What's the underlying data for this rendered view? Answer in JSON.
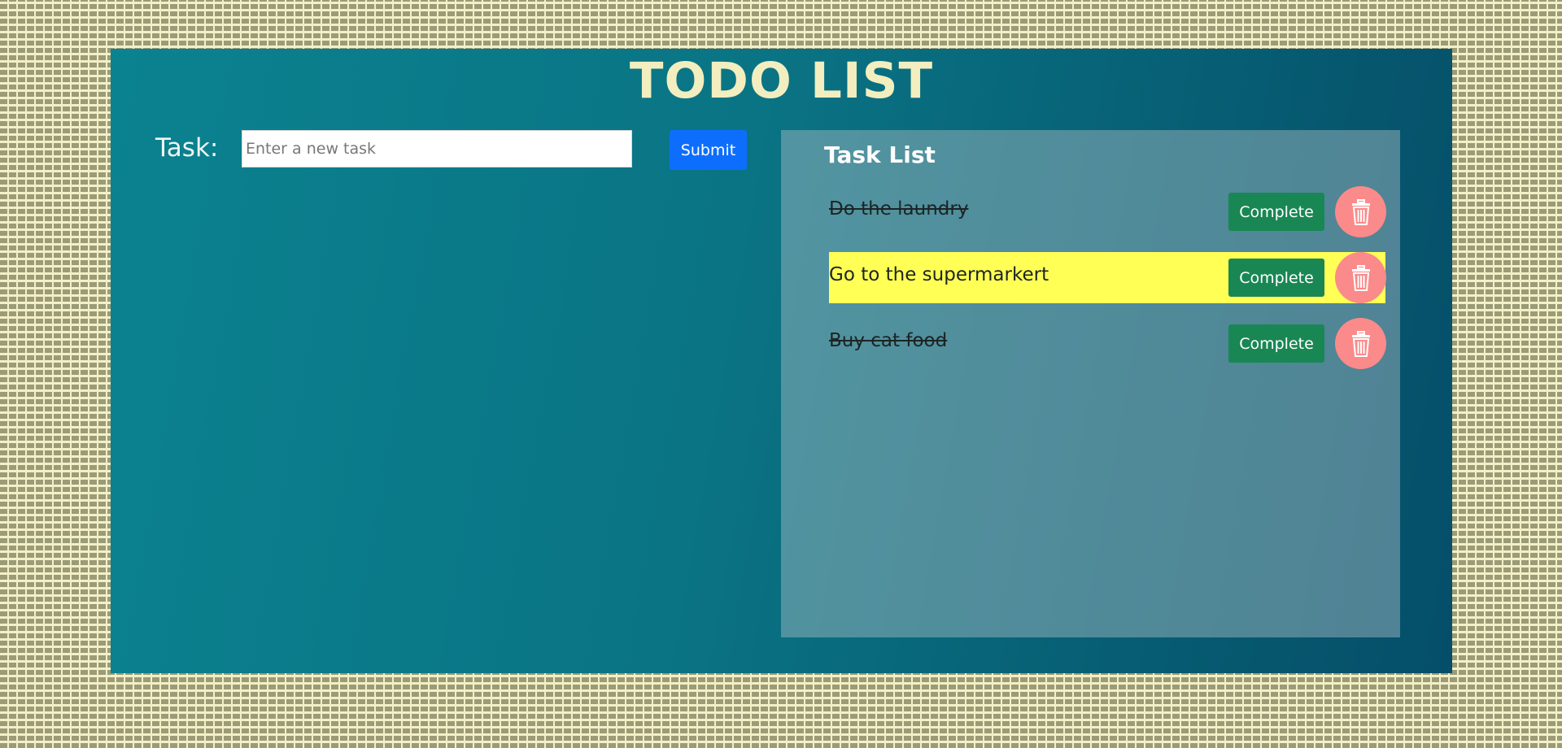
{
  "app": {
    "title": "TODO LIST"
  },
  "form": {
    "label": "Task:",
    "input_value": "",
    "input_placeholder": "Enter a new task",
    "submit_label": "Submit"
  },
  "task_list": {
    "title": "Task List",
    "complete_label": "Complete",
    "delete_icon": "trash-icon",
    "items": [
      {
        "text": "Do the laundry",
        "completed": true,
        "highlighted": false
      },
      {
        "text": "Go to the supermarkert",
        "completed": false,
        "highlighted": true
      },
      {
        "text": "Buy cat food",
        "completed": true,
        "highlighted": false
      }
    ]
  },
  "colors": {
    "title": "#f2eec0",
    "submit": "#0d6efd",
    "complete": "#198754",
    "delete": "#fb8a8a",
    "highlight": "#ffff55"
  }
}
